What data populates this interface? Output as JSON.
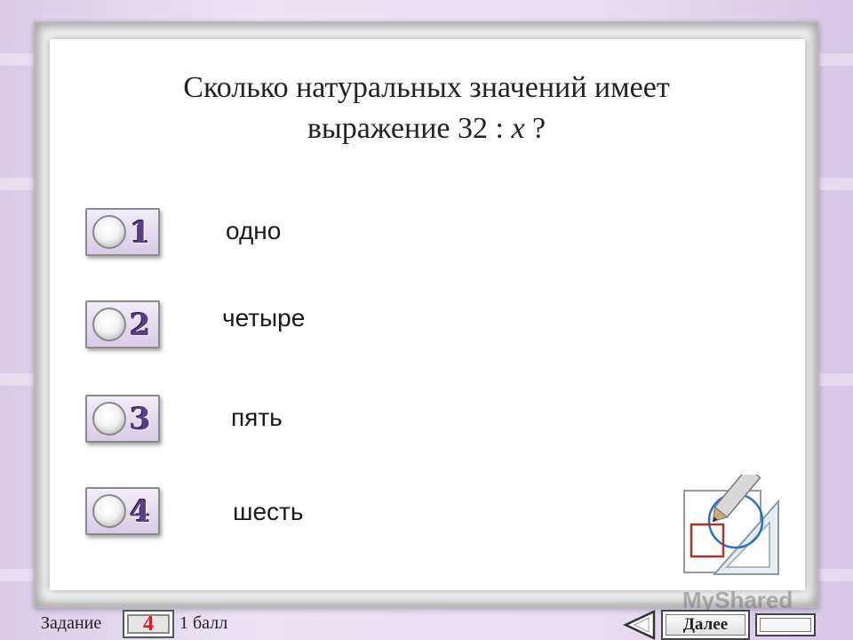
{
  "question": {
    "line1": "Сколько натуральных значений имеет",
    "line2_prefix": "выражение 32 : ",
    "line2_var": "x",
    "line2_suffix": " ?"
  },
  "options": [
    {
      "number": "1",
      "text": "одно"
    },
    {
      "number": "2",
      "text": "четыре"
    },
    {
      "number": "3",
      "text": "пять"
    },
    {
      "number": "4",
      "text": "шесть"
    }
  ],
  "footer": {
    "task_label": "Задание",
    "task_number": "4",
    "score_label": "1 балл",
    "next_label": "Далее"
  },
  "watermark": "MyShared",
  "colors": {
    "accent": "#5a3f86",
    "task_number": "#d4202a",
    "background": "#e4d8ee"
  },
  "icons": [
    "radio-button-icon",
    "back-arrow-icon",
    "geometry-pencil-icon"
  ]
}
